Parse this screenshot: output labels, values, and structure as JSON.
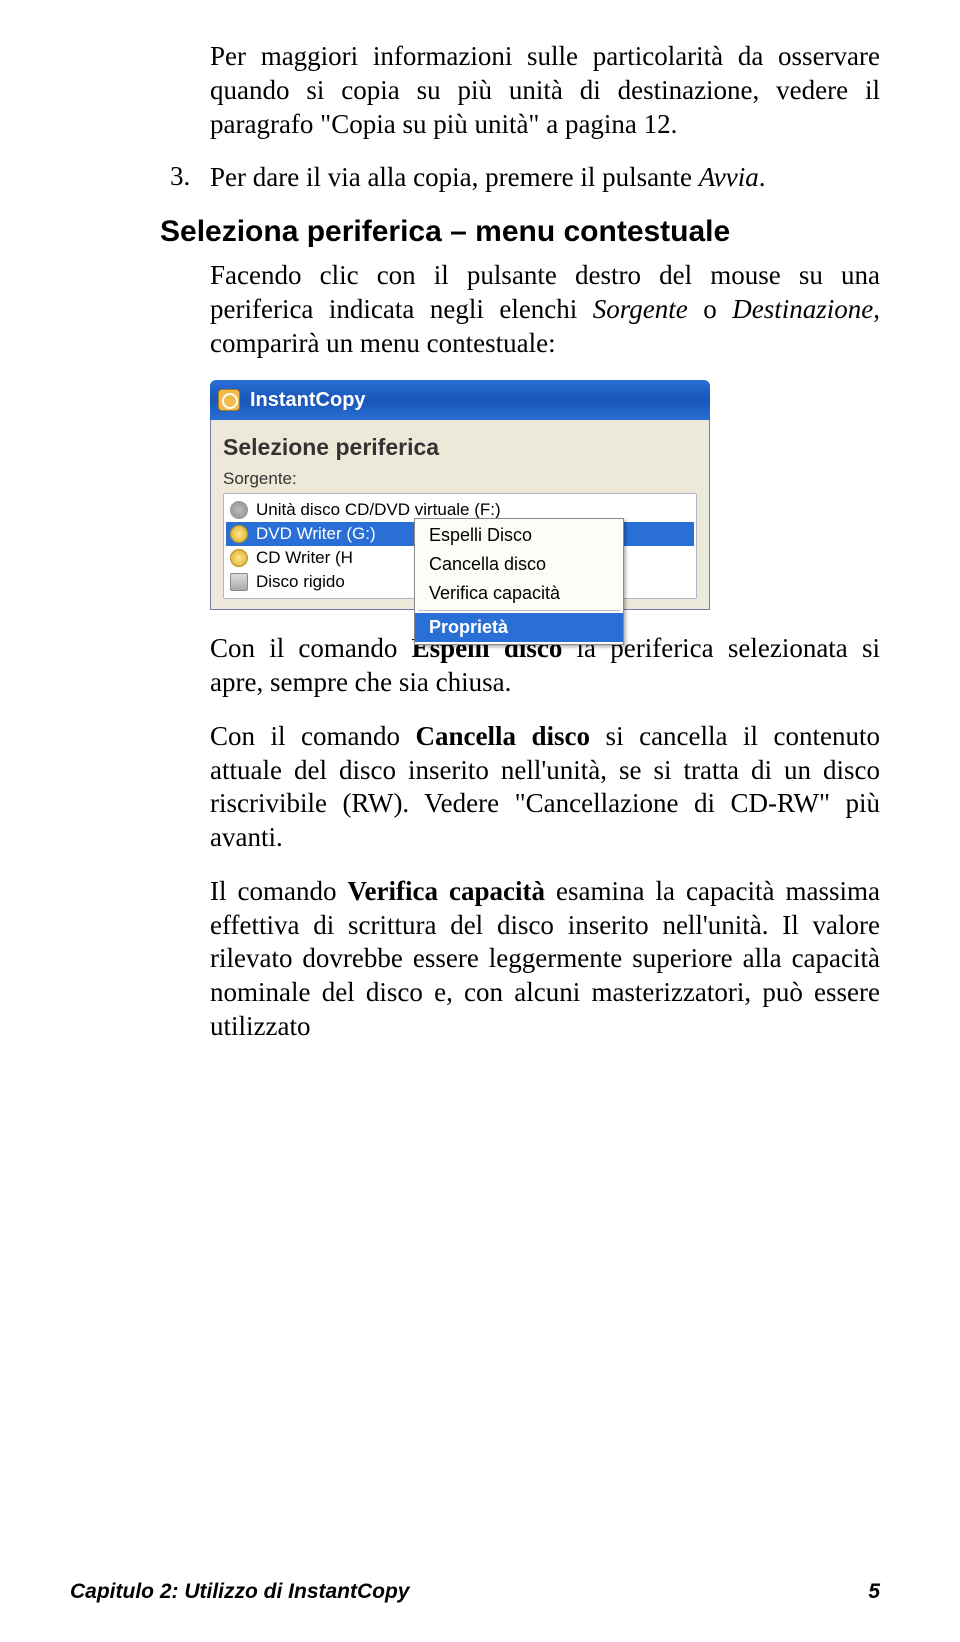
{
  "body": {
    "p1_a": "Per maggiori informazioni sulle particolarità da osservare quando si copia su più unità di destinazione, vedere il paragrafo \"Copia su più unità\" a pagina 12.",
    "item3_num": "3.",
    "item3_a": "Per dare il via alla copia, premere il pulsante ",
    "item3_b": "Avvia",
    "item3_c": ".",
    "h2": "Seleziona periferica – menu contestuale",
    "p2_a": "Facendo clic con il pulsante destro del mouse su una periferica indicata negli elenchi ",
    "p2_b": "Sorgente",
    "p2_c": " o ",
    "p2_d": "Destinazione",
    "p2_e": ", comparirà un menu contestuale:",
    "p3_a": "Con il comando ",
    "p3_b": "Espelli disco",
    "p3_c": " la periferica selezionata si apre, sempre che sia chiusa.",
    "p4_a": "Con il comando ",
    "p4_b": "Cancella disco",
    "p4_c": " si cancella il contenuto attuale del disco inserito nell'unità, se si tratta di un disco riscrivibile (RW). Vedere \"Cancellazione di CD-RW\" più avanti.",
    "p5_a": "Il comando ",
    "p5_b": "Verifica capacità",
    "p5_c": " esamina la capacità massima effettiva di scrittura del disco inserito nell'unità. Il valore rilevato dovrebbe essere leggermente superiore alla capacità nominale del disco e, con alcuni masterizzatori, può essere utilizzato"
  },
  "ui": {
    "app_title": "InstantCopy",
    "group_title": "Selezione periferica",
    "source_label": "Sorgente:",
    "items": {
      "virtual": "Unità disco CD/DVD virtuale (F:)",
      "dvd": "DVD Writer (G:)",
      "cd": "CD Writer (H",
      "hdd": "Disco rigido"
    },
    "ctx": {
      "eject": "Espelli Disco",
      "erase": "Cancella disco",
      "verify": "Verifica capacità",
      "props": "Proprietà"
    }
  },
  "footer": {
    "left": "Capitulo 2: Utilizzo di InstantCopy",
    "right": "5"
  }
}
